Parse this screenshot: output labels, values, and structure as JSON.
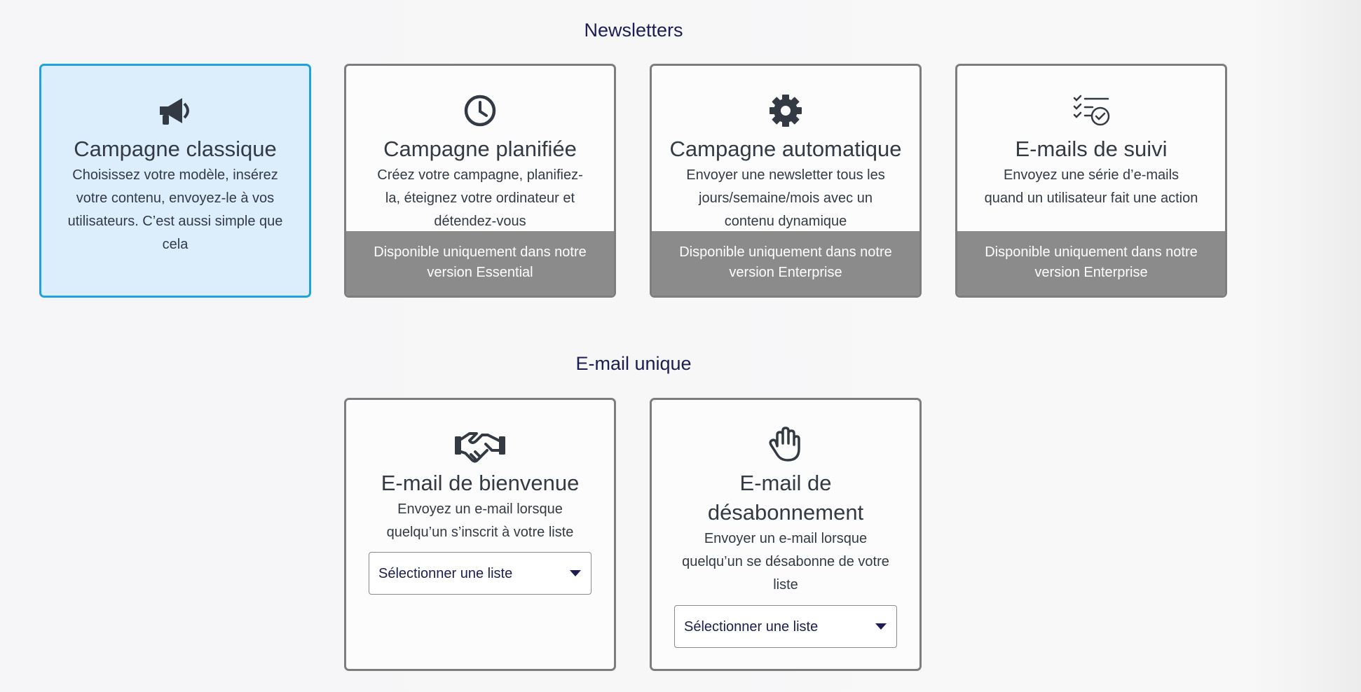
{
  "newsletters": {
    "title": "Newsletters",
    "cards": [
      {
        "icon": "megaphone-icon",
        "title": "Campagne classique",
        "description": "Choisissez votre modèle, insérez votre contenu, envoyez-le à vos utilisateurs. C’est aussi simple que cela",
        "selected": true
      },
      {
        "icon": "clock-icon",
        "title": "Campagne planifiée",
        "description": "Créez votre campagne, planifiez-la, éteignez votre ordinateur et détendez-vous",
        "notice": "Disponible uniquement dans notre version Essential"
      },
      {
        "icon": "gear-icon",
        "title": "Campagne automatique",
        "description": "Envoyer une newsletter tous les jours/semaine/mois avec un contenu dynamique",
        "notice": "Disponible uniquement dans notre version Enterprise"
      },
      {
        "icon": "checklist-clock-icon",
        "title": "E-mails de suivi",
        "description": "Envoyez une série d’e-mails quand un utilisateur fait une action",
        "notice": "Disponible uniquement dans notre version Enterprise"
      }
    ]
  },
  "unique": {
    "title": "E-mail unique",
    "cards": [
      {
        "icon": "handshake-icon",
        "title": "E-mail de bienvenue",
        "description": "Envoyez un e-mail lorsque quelqu’un s’inscrit à votre liste",
        "select_label": "Sélectionner une liste"
      },
      {
        "icon": "hand-icon",
        "title": "E-mail de désabonnement",
        "description": "Envoyer un e-mail lorsque quelqu’un se désabonne de votre liste",
        "select_label": "Sélectionner une liste"
      }
    ]
  },
  "colors": {
    "section_title": "#1c1d52",
    "selected_border": "#1ea3e0",
    "selected_bg": "#dcedfc",
    "notice_bg": "#8b8b8b"
  }
}
